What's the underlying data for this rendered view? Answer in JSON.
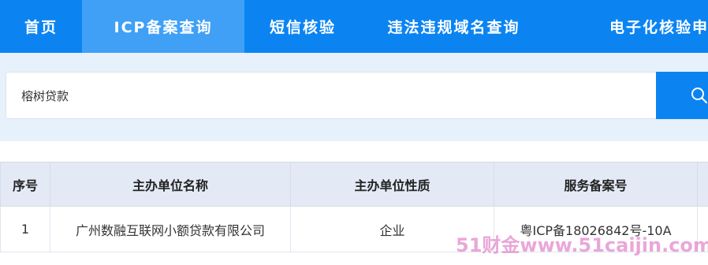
{
  "nav": {
    "items": [
      {
        "label": "首页"
      },
      {
        "label": "ICP备案查询"
      },
      {
        "label": "短信核验"
      },
      {
        "label": "违法违规域名查询"
      },
      {
        "label": "电子化核验申"
      }
    ]
  },
  "search": {
    "value": "榕树贷款"
  },
  "table": {
    "headers": [
      "序号",
      "主办单位名称",
      "主办单位性质",
      "服务备案号",
      ""
    ],
    "rows": [
      {
        "no": "1",
        "name": "广州数融互联网小额贷款有限公司",
        "type": "企业",
        "license": "粤ICP备18026842号-10A",
        "extra": ""
      }
    ]
  },
  "watermark": "51财金www.51caijin.com",
  "colors": {
    "nav_bg": "#0b84f2",
    "nav_active": "#3fa0f5",
    "search_area_bg": "#e6f1fc",
    "header_bg": "#e3eaf6"
  },
  "icons": {
    "search_button": "search-icon"
  }
}
